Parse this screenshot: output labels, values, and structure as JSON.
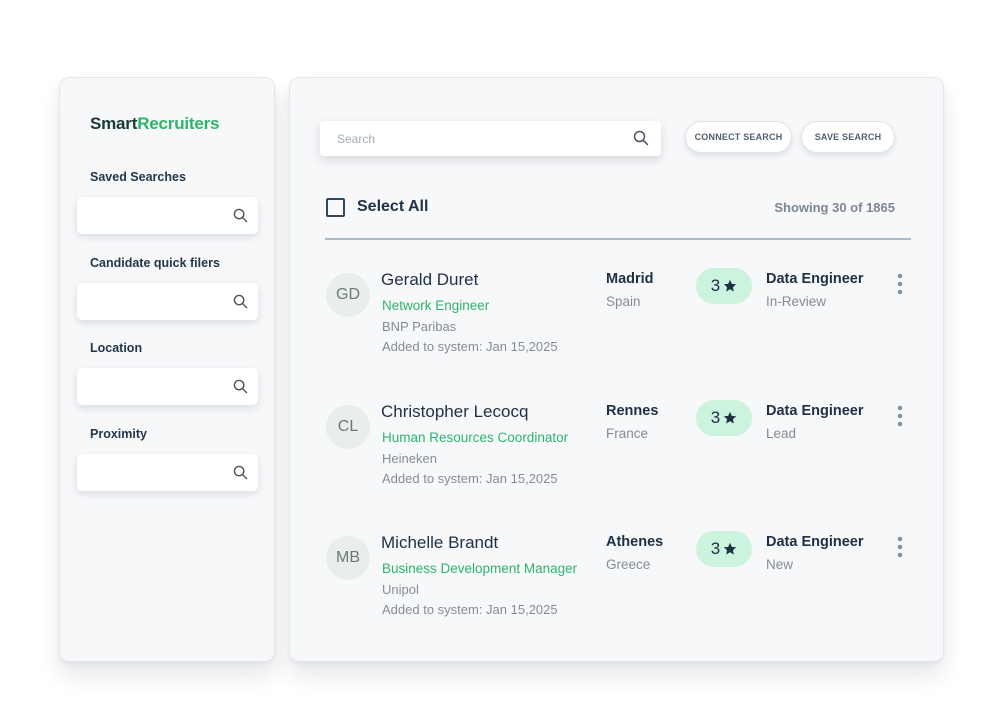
{
  "brand": {
    "part1": "Smart",
    "part2": "Recruiters"
  },
  "sidebar": {
    "filters": [
      {
        "label": "Saved Searches",
        "value": ""
      },
      {
        "label": "Candidate quick filers",
        "value": ""
      },
      {
        "label": "Location",
        "value": ""
      },
      {
        "label": "Proximity",
        "value": ""
      }
    ]
  },
  "search": {
    "placeholder": "Search",
    "value": ""
  },
  "actions": {
    "connect": "CONNECT SEARCH",
    "save": "SAVE SEARCH"
  },
  "list": {
    "select_all": "Select All",
    "select_all_checked": false,
    "showing": "Showing 30 of 1865"
  },
  "candidates": [
    {
      "initials": "GD",
      "name": "Gerald Duret",
      "title": "Network Engineer",
      "company": "BNP Paribas",
      "added": "Added to system: Jan 15,2025",
      "city": "Madrid",
      "country": "Spain",
      "rating": "3",
      "job": "Data Engineer",
      "status": "In-Review"
    },
    {
      "initials": "CL",
      "name": "Christopher Lecocq",
      "title": "Human Resources Coordinator",
      "company": "Heineken",
      "added": "Added to system: Jan 15,2025",
      "city": "Rennes",
      "country": "France",
      "rating": "3",
      "job": "Data Engineer",
      "status": "Lead"
    },
    {
      "initials": "MB",
      "name": "Michelle Brandt",
      "title": "Business Development Manager",
      "company": "Unipol",
      "added": "Added to system: Jan 15,2025",
      "city": "Athenes",
      "country": "Greece",
      "rating": "3",
      "job": "Data Engineer",
      "status": "New"
    }
  ],
  "icons": {
    "search": "search-icon",
    "star": "star-icon",
    "more": "kebab-menu-icon",
    "checkbox": "checkbox-icon"
  },
  "colors": {
    "brand_dark": "#1b3a35",
    "brand_green": "#2fb46a",
    "rating_bg": "#ccf3dd",
    "text_dark": "#1f3045",
    "text_muted": "#848d96"
  }
}
